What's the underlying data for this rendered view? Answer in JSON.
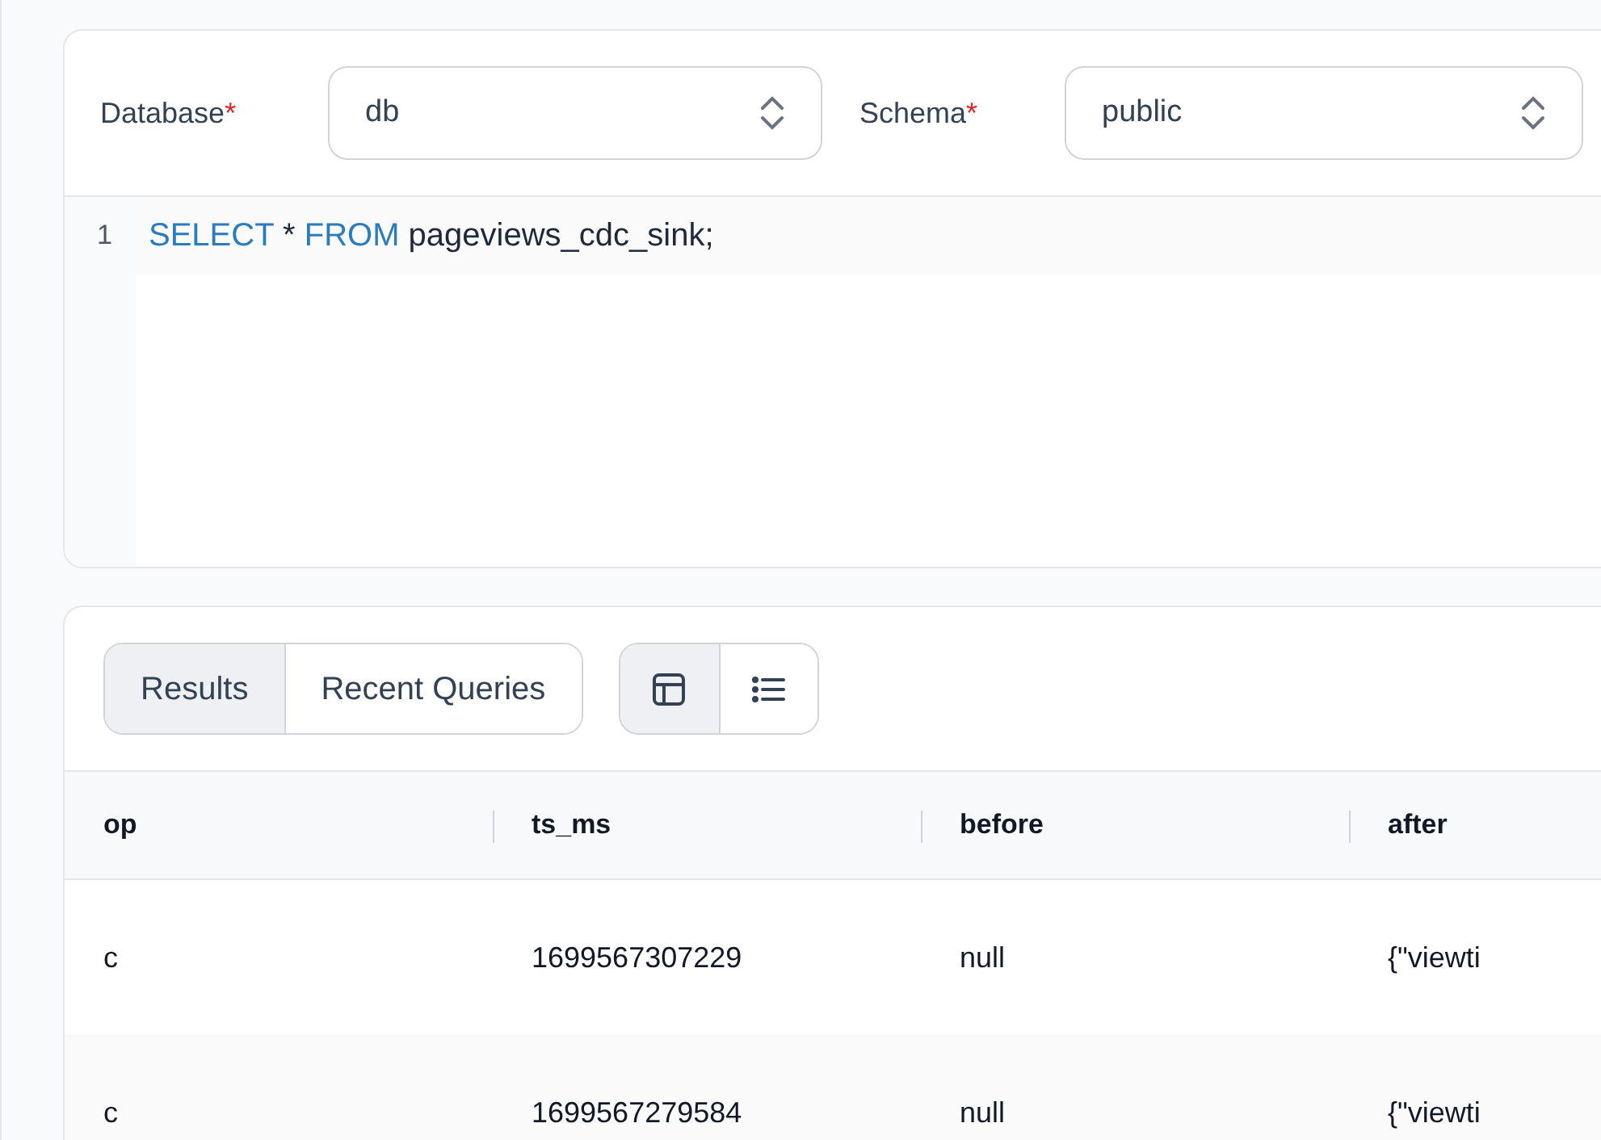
{
  "query_form": {
    "fields": [
      {
        "label": "Database",
        "required": true,
        "value": "db"
      },
      {
        "label": "Schema",
        "required": true,
        "value": "public"
      }
    ]
  },
  "editor": {
    "lines": [
      {
        "number": "1",
        "tokens": [
          {
            "kind": "keyword",
            "text": "SELECT"
          },
          {
            "kind": "plain",
            "text": " * "
          },
          {
            "kind": "keyword",
            "text": "FROM"
          },
          {
            "kind": "plain",
            "text": " pageviews_cdc_sink;"
          }
        ]
      }
    ]
  },
  "result_tabs": [
    {
      "label": "Results",
      "selected": true
    },
    {
      "label": "Recent Queries",
      "selected": false
    }
  ],
  "view_toggle": [
    {
      "kind": "table",
      "selected": true
    },
    {
      "kind": "list",
      "selected": false
    }
  ],
  "table": {
    "columns": [
      "op",
      "ts_ms",
      "before",
      "after"
    ],
    "rows": [
      [
        "c",
        "1699567307229",
        "null",
        "{\"viewti"
      ],
      [
        "c",
        "1699567279584",
        "null",
        "{\"viewti"
      ]
    ]
  }
}
